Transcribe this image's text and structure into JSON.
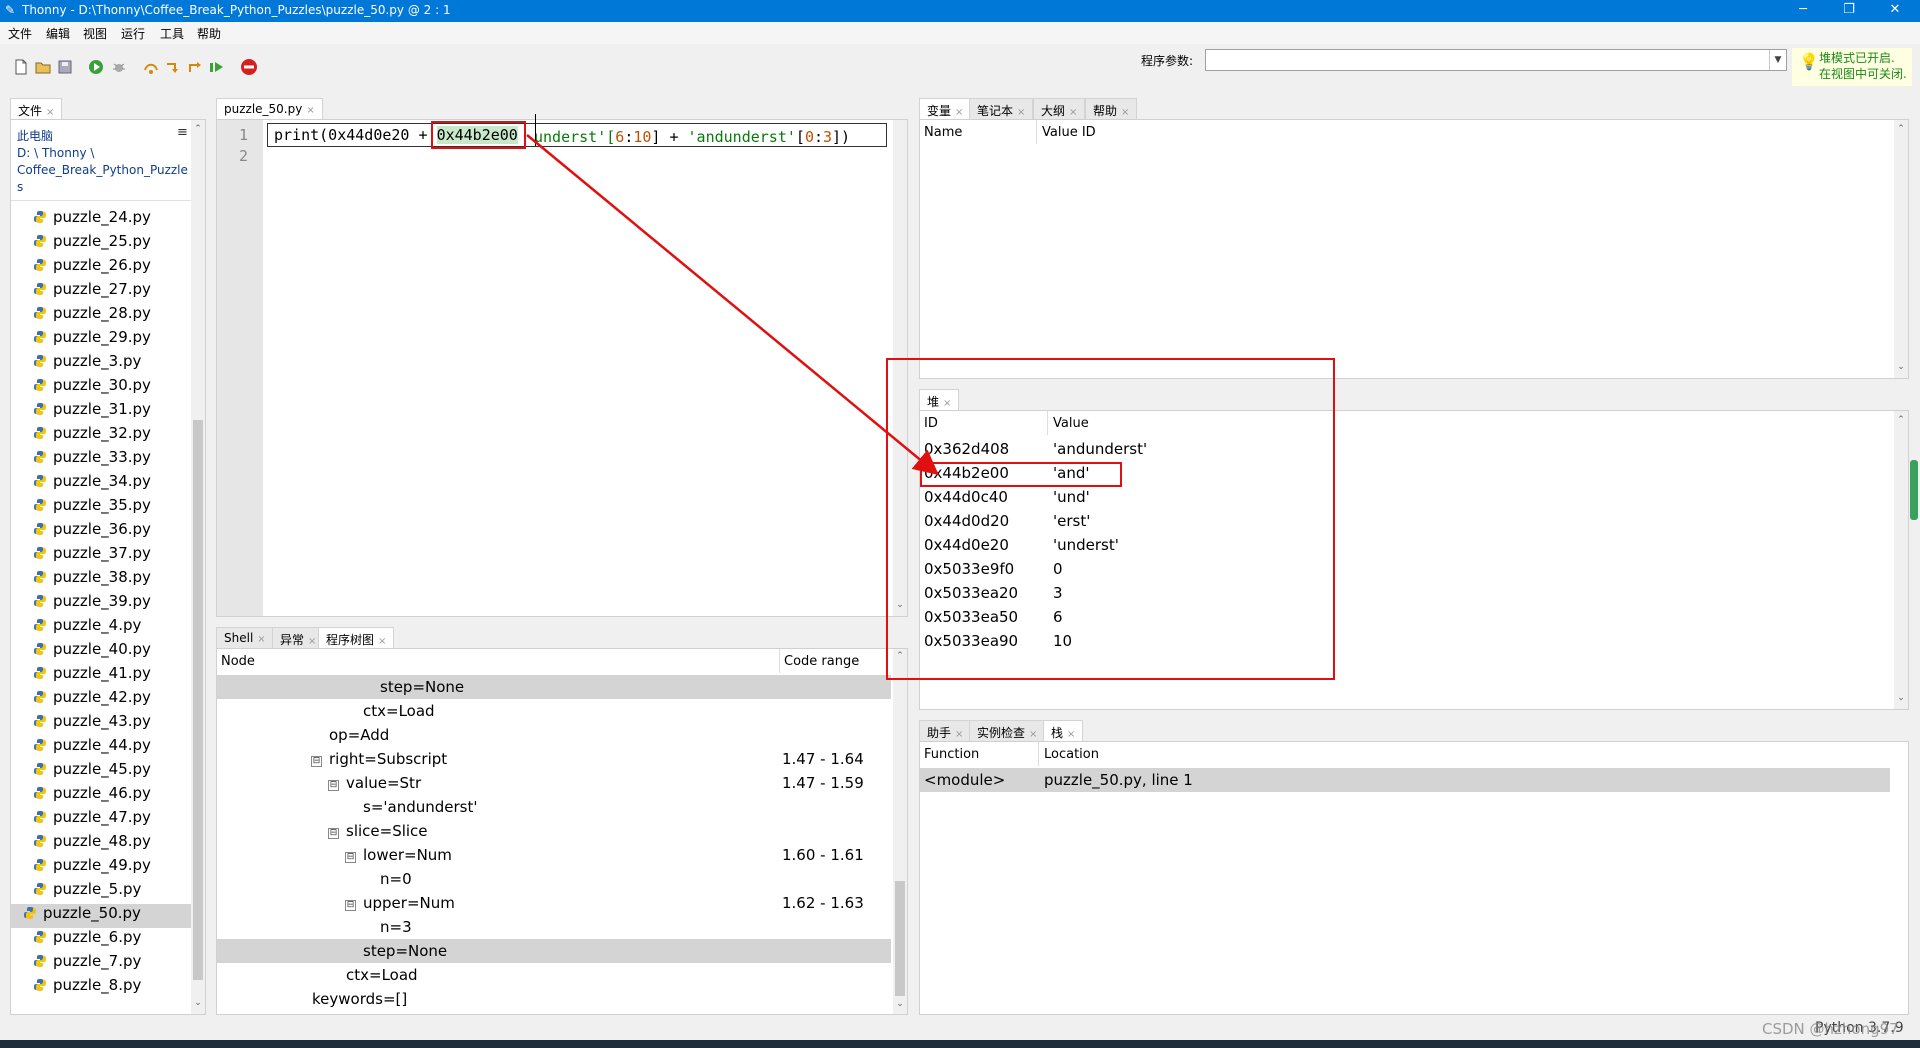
{
  "window": {
    "title": "Thonny  -  D:\\Thonny\\Coffee_Break_Python_Puzzles\\puzzle_50.py  @  2 : 1",
    "minimize": "─",
    "maximize": "❐",
    "close": "✕"
  },
  "menu": [
    "文件",
    "编辑",
    "视图",
    "运行",
    "工具",
    "帮助"
  ],
  "toolbar": {
    "args_label": "程序参数:",
    "args_value": "",
    "tip_line1": "堆模式已开启.",
    "tip_line2": "在视图中可关闭."
  },
  "files": {
    "tab": "文件",
    "location_title": "此电脑",
    "path_line1": "D: \\ Thonny \\",
    "path_line2": "Coffee_Break_Python_Puzzle",
    "path_line3": "s",
    "menu_glyph": "≡",
    "items": [
      "puzzle_24.py",
      "puzzle_25.py",
      "puzzle_26.py",
      "puzzle_27.py",
      "puzzle_28.py",
      "puzzle_29.py",
      "puzzle_3.py",
      "puzzle_30.py",
      "puzzle_31.py",
      "puzzle_32.py",
      "puzzle_33.py",
      "puzzle_34.py",
      "puzzle_35.py",
      "puzzle_36.py",
      "puzzle_37.py",
      "puzzle_38.py",
      "puzzle_39.py",
      "puzzle_4.py",
      "puzzle_40.py",
      "puzzle_41.py",
      "puzzle_42.py",
      "puzzle_43.py",
      "puzzle_44.py",
      "puzzle_45.py",
      "puzzle_46.py",
      "puzzle_47.py",
      "puzzle_48.py",
      "puzzle_49.py",
      "puzzle_5.py",
      "puzzle_50.py",
      "puzzle_6.py",
      "puzzle_7.py",
      "puzzle_8.py"
    ],
    "selected": "puzzle_50.py"
  },
  "editor": {
    "tab": "puzzle_50.py",
    "line_numbers": [
      "1",
      "2"
    ],
    "code_part1": "print(0x44d0e20 + ",
    "code_highlight": "0x44b2e00",
    "code_part2": "underst'[6:10] + 'andunderst'[0:3])",
    "code_tail_a": "underst'[",
    "code_num1": "6",
    "code_colon1": ":",
    "code_num2": "10",
    "code_mid": "] + ",
    "code_str": "'andunderst'",
    "code_br": "[",
    "code_num3": "0",
    "code_colon2": ":",
    "code_num4": "3",
    "code_end": "])"
  },
  "bottom_tabs": [
    "Shell",
    "异常",
    "程序树图"
  ],
  "tree": {
    "col_node": "Node",
    "col_range": "Code range",
    "rows": [
      {
        "indent": 3,
        "exp": "",
        "node": "step=None",
        "range": "",
        "sel": true
      },
      {
        "indent": 2,
        "exp": "",
        "node": "ctx=Load",
        "range": "",
        "sel": false
      },
      {
        "indent": 0,
        "exp": "",
        "node": "op=Add",
        "range": "",
        "sel": false
      },
      {
        "indent": 0,
        "exp": "⊟",
        "node": "right=Subscript",
        "range": "1.47  -  1.64",
        "sel": false
      },
      {
        "indent": 1,
        "exp": "⊟",
        "node": "value=Str",
        "range": "1.47  -  1.59",
        "sel": false
      },
      {
        "indent": 2,
        "exp": "",
        "node": "s='andunderst'",
        "range": "",
        "sel": false
      },
      {
        "indent": 1,
        "exp": "⊟",
        "node": "slice=Slice",
        "range": "",
        "sel": false
      },
      {
        "indent": 2,
        "exp": "⊟",
        "node": "lower=Num",
        "range": "1.60  -  1.61",
        "sel": false
      },
      {
        "indent": 3,
        "exp": "",
        "node": "n=0",
        "range": "",
        "sel": false
      },
      {
        "indent": 2,
        "exp": "⊟",
        "node": "upper=Num",
        "range": "1.62  -  1.63",
        "sel": false
      },
      {
        "indent": 3,
        "exp": "",
        "node": "n=3",
        "range": "",
        "sel": false
      },
      {
        "indent": 2,
        "exp": "",
        "node": "step=None",
        "range": "",
        "sel": true
      },
      {
        "indent": 1,
        "exp": "",
        "node": "ctx=Load",
        "range": "",
        "sel": false
      },
      {
        "indent": -1,
        "exp": "",
        "node": "keywords=[]",
        "range": "",
        "sel": false
      }
    ]
  },
  "vars_tabs": [
    "变量",
    "笔记本",
    "大纲",
    "帮助"
  ],
  "vars": {
    "col_name": "Name",
    "col_id": "Value ID"
  },
  "heap": {
    "tab": "堆",
    "col_id": "ID",
    "col_value": "Value",
    "rows": [
      {
        "id": "0x362d408",
        "value": "'andunderst'"
      },
      {
        "id": "0x44b2e00",
        "value": "'and'"
      },
      {
        "id": "0x44d0c40",
        "value": "'und'"
      },
      {
        "id": "0x44d0d20",
        "value": "'erst'"
      },
      {
        "id": "0x44d0e20",
        "value": "'underst'"
      },
      {
        "id": "0x5033e9f0",
        "value": "0"
      },
      {
        "id": "0x5033ea20",
        "value": "3"
      },
      {
        "id": "0x5033ea50",
        "value": "6"
      },
      {
        "id": "0x5033ea90",
        "value": "10"
      }
    ]
  },
  "stack_tabs": [
    "助手",
    "实例检查",
    "栈"
  ],
  "stack": {
    "col_function": "Function",
    "col_location": "Location",
    "rows": [
      {
        "function": "<module>",
        "location": "puzzle_50.py, line 1"
      }
    ]
  },
  "status": {
    "interpreter": "Python 3.7.9",
    "watermark": "CSDN @hzhong97"
  },
  "colors": {
    "accent": "#0078d7",
    "annotation": "#e01010"
  }
}
